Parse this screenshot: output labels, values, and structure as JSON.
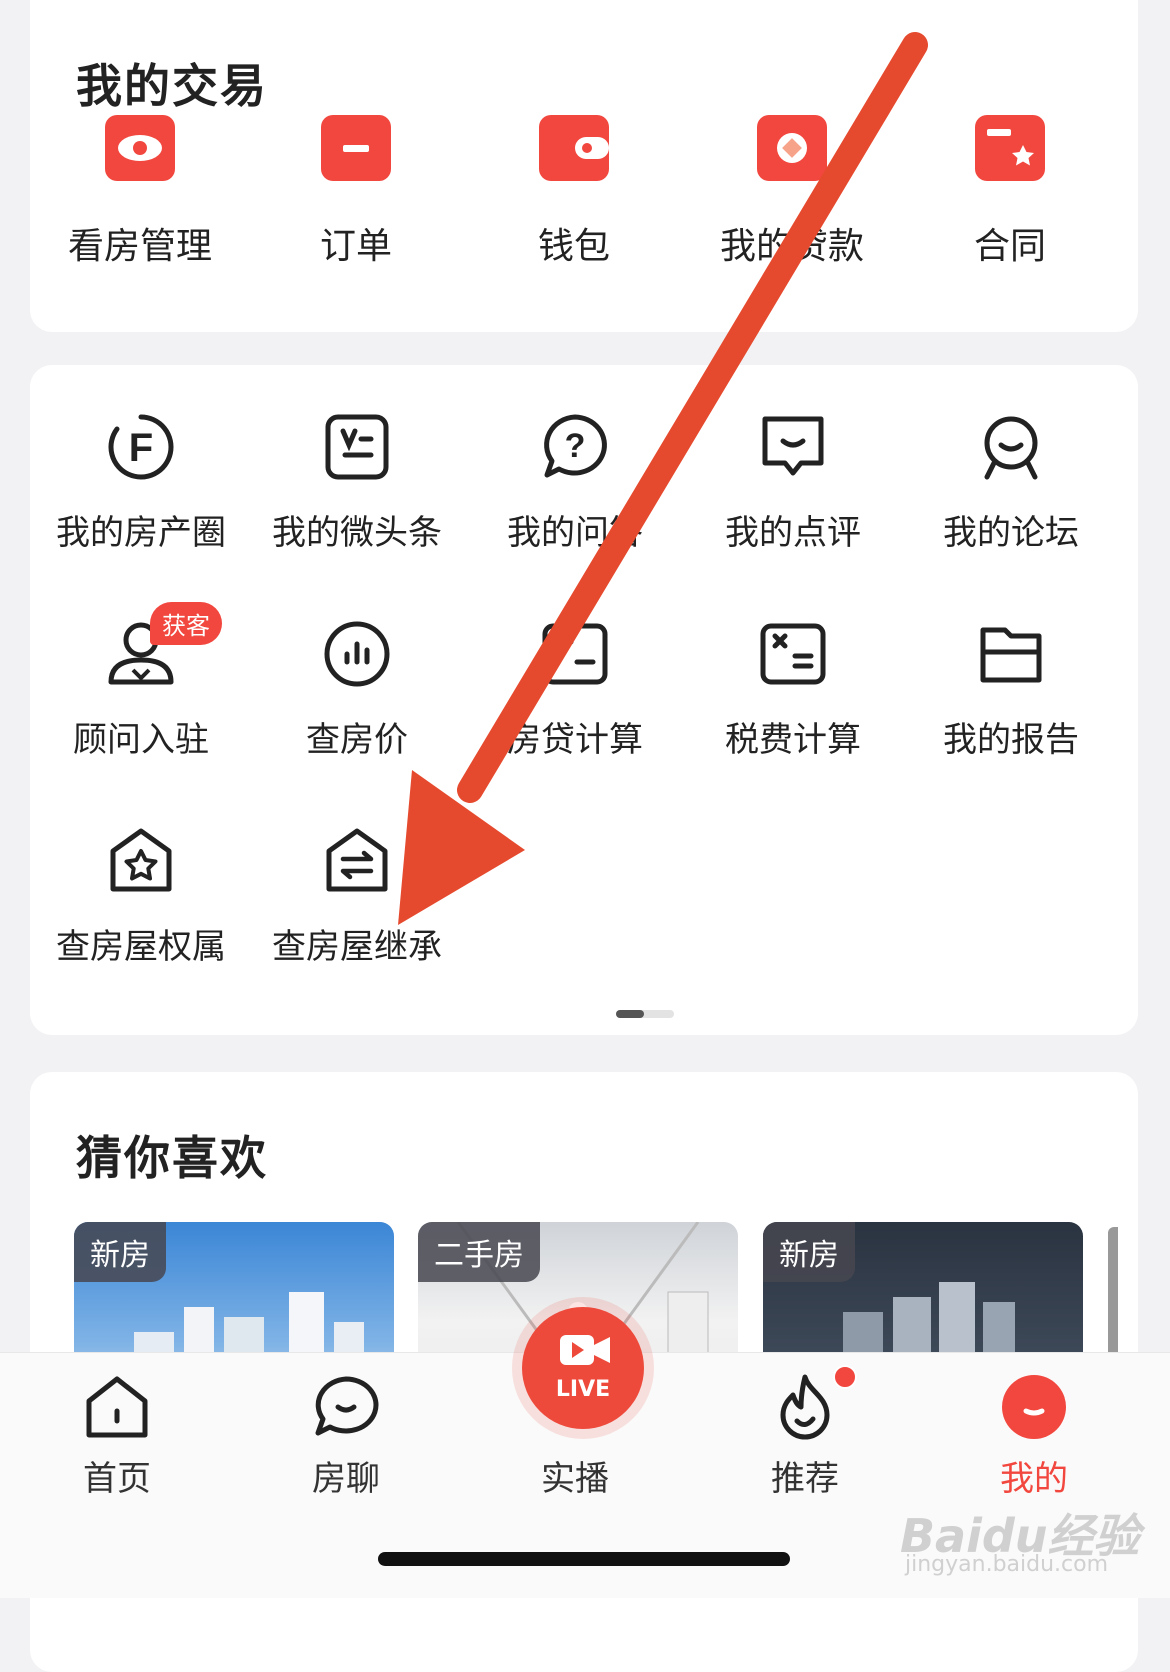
{
  "trade": {
    "title": "我的交易",
    "items": [
      {
        "label": "看房管理",
        "icon": "eye-icon"
      },
      {
        "label": "订单",
        "icon": "clipboard-icon"
      },
      {
        "label": "钱包",
        "icon": "wallet-icon"
      },
      {
        "label": "我的贷款",
        "icon": "loan-icon"
      },
      {
        "label": "合同",
        "icon": "contract-icon"
      }
    ]
  },
  "tools": {
    "items": [
      {
        "label": "我的房产圈",
        "icon": "circle-f-icon"
      },
      {
        "label": "我的微头条",
        "icon": "microheadline-icon"
      },
      {
        "label": "我的问答",
        "icon": "question-icon"
      },
      {
        "label": "我的点评",
        "icon": "comment-icon"
      },
      {
        "label": "我的论坛",
        "icon": "forum-icon"
      },
      {
        "label": "顾问入驻",
        "icon": "advisor-icon",
        "badge": "获客"
      },
      {
        "label": "查房价",
        "icon": "price-chart-icon"
      },
      {
        "label": "房贷计算",
        "icon": "mortgage-calc-icon"
      },
      {
        "label": "税费计算",
        "icon": "tax-calc-icon"
      },
      {
        "label": "我的报告",
        "icon": "folder-icon"
      },
      {
        "label": "查房屋权属",
        "icon": "house-star-icon"
      },
      {
        "label": "查房屋继承",
        "icon": "house-transfer-icon"
      }
    ]
  },
  "guess": {
    "title": "猜你喜欢",
    "cards": [
      {
        "tag": "新房"
      },
      {
        "tag": "二手房"
      },
      {
        "tag": "新房"
      }
    ]
  },
  "tabbar": {
    "items": [
      {
        "label": "首页",
        "icon": "home-icon"
      },
      {
        "label": "房聊",
        "icon": "chat-icon"
      },
      {
        "label": "实播",
        "icon": "live-icon",
        "badge": "LIVE"
      },
      {
        "label": "推荐",
        "icon": "flame-icon"
      },
      {
        "label": "我的",
        "icon": "profile-icon",
        "active": true
      }
    ]
  },
  "watermark": {
    "brand": "Baidu经验",
    "url": "jingyan.baidu.com"
  },
  "colors": {
    "accent": "#f2473e",
    "arrow": "#e64a2e"
  }
}
